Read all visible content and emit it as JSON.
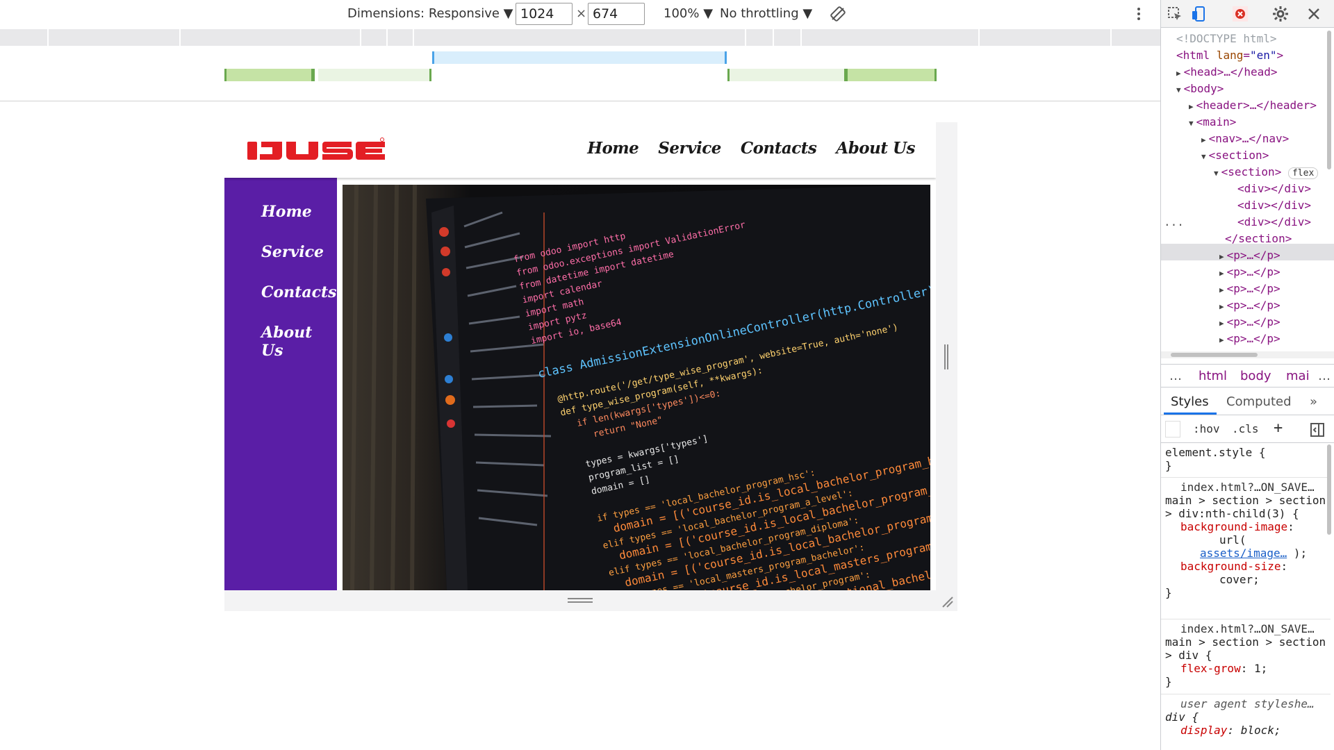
{
  "device_toolbar": {
    "dimensions_label": "Dimensions: Responsive",
    "width_value": "1024",
    "times": "×",
    "height_value": "674",
    "zoom": "100%",
    "throttling": "No throttling"
  },
  "site": {
    "logo_text": "IJSE",
    "brand_color": "#e31e24",
    "nav_color": "#5a1ea6",
    "top_nav": [
      "Home",
      "Service",
      "Contacts",
      "About Us"
    ],
    "side_nav": [
      "Home",
      "Service",
      "Contacts",
      "About Us"
    ],
    "hero_image": "code-editor-screenshot"
  },
  "devtools": {
    "dom": {
      "doctype": "<!DOCTYPE html>",
      "html_tag": "html",
      "lang_attr": "lang",
      "lang_value": "\"en\"",
      "head": "<head>…</head>",
      "body": "<body>",
      "header": "<header>…</header>",
      "main": "<main>",
      "nav": "<nav>…</nav>",
      "section": "<section>",
      "inner_section": "<section>",
      "flex_badge": "flex",
      "div": "<div></div>",
      "section_close": "</section>",
      "p": "<p>…</p>",
      "ellipsis": "..."
    },
    "breadcrumbs": [
      "…",
      "html",
      "body",
      "mai",
      "…"
    ],
    "tabs": {
      "styles": "Styles",
      "computed": "Computed",
      "more": "»"
    },
    "filter": {
      "hov": ":hov",
      "cls": ".cls",
      "add": "+"
    },
    "rules": {
      "element_style": "element.style {",
      "close": "}",
      "src1": "index.html?…ON_SAVE…",
      "sel1": "main > section > section > div:nth-child(3) {",
      "p1_name": "background-image",
      "p1_val_a": "url(",
      "p1_link": "assets/image…",
      "p1_val_b": ");",
      "p2_name": "background-size",
      "p2_val": "cover;",
      "src2": "index.html?…ON_SAVE…",
      "sel2": "main > section > section > div {",
      "p3_name": "flex-grow",
      "p3_val": "1;",
      "ua": "user agent styleshe…",
      "sel3": "div {",
      "p4_name": "display",
      "p4_val": "block;"
    }
  }
}
